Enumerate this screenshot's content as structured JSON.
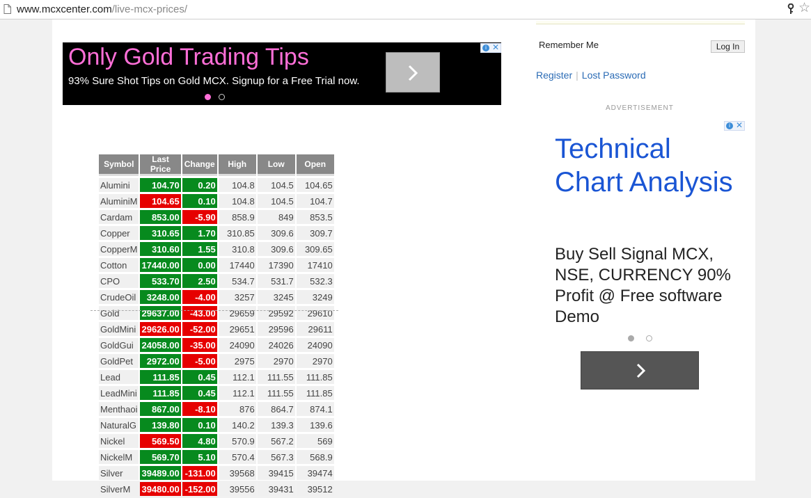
{
  "browser": {
    "url_domain": "www.mcxcenter.com",
    "url_path": "/live-mcx-prices/"
  },
  "ad_top": {
    "headline": "Only Gold Trading Tips",
    "subtext": "93% Sure Shot Tips on Gold MCX. Signup for a Free Trial now."
  },
  "login": {
    "remember_me": "Remember Me",
    "log_in_button": "Log In",
    "register_link": "Register",
    "separator": "|",
    "lost_password_link": "Lost Password"
  },
  "advertisement_label": "ADVERTISEMENT",
  "ad_side": {
    "headline": "Technical Chart Analysis",
    "body": "Buy Sell Signal MCX, NSE, CURRENCY 90% Profit @ Free software Demo"
  },
  "colors": {
    "up": "#078a1e",
    "down": "#e60000",
    "header": "#888888"
  },
  "table": {
    "headers": [
      "Symbol",
      "Last Price",
      "Change",
      "High",
      "Low",
      "Open"
    ],
    "rows": [
      {
        "symbol": "Alumini",
        "last": "104.70",
        "last_dir": "up",
        "change": "0.20",
        "change_dir": "up",
        "high": "104.8",
        "low": "104.5",
        "open": "104.65"
      },
      {
        "symbol": "AluminiM",
        "last": "104.65",
        "last_dir": "down",
        "change": "0.10",
        "change_dir": "up",
        "high": "104.8",
        "low": "104.5",
        "open": "104.7"
      },
      {
        "symbol": "Cardam",
        "last": "853.00",
        "last_dir": "up",
        "change": "-5.90",
        "change_dir": "down",
        "high": "858.9",
        "low": "849",
        "open": "853.5"
      },
      {
        "symbol": "Copper",
        "last": "310.65",
        "last_dir": "up",
        "change": "1.70",
        "change_dir": "up",
        "high": "310.85",
        "low": "309.6",
        "open": "309.7"
      },
      {
        "symbol": "CopperM",
        "last": "310.60",
        "last_dir": "up",
        "change": "1.55",
        "change_dir": "up",
        "high": "310.8",
        "low": "309.6",
        "open": "309.65"
      },
      {
        "symbol": "Cotton",
        "last": "17440.00",
        "last_dir": "up",
        "change": "0.00",
        "change_dir": "up",
        "high": "17440",
        "low": "17390",
        "open": "17410"
      },
      {
        "symbol": "CPO",
        "last": "533.70",
        "last_dir": "up",
        "change": "2.50",
        "change_dir": "up",
        "high": "534.7",
        "low": "531.7",
        "open": "532.3"
      },
      {
        "symbol": "CrudeOil",
        "last": "3248.00",
        "last_dir": "up",
        "change": "-4.00",
        "change_dir": "down",
        "high": "3257",
        "low": "3245",
        "open": "3249"
      },
      {
        "symbol": "Gold",
        "last": "29637.00",
        "last_dir": "up",
        "change": "-43.00",
        "change_dir": "down",
        "high": "29659",
        "low": "29592",
        "open": "29610"
      },
      {
        "symbol": "GoldMini",
        "last": "29626.00",
        "last_dir": "down",
        "change": "-52.00",
        "change_dir": "down",
        "high": "29651",
        "low": "29596",
        "open": "29611"
      },
      {
        "symbol": "GoldGui",
        "last": "24058.00",
        "last_dir": "up",
        "change": "-35.00",
        "change_dir": "down",
        "high": "24090",
        "low": "24026",
        "open": "24090"
      },
      {
        "symbol": "GoldPet",
        "last": "2972.00",
        "last_dir": "up",
        "change": "-5.00",
        "change_dir": "down",
        "high": "2975",
        "low": "2970",
        "open": "2970"
      },
      {
        "symbol": "Lead",
        "last": "111.85",
        "last_dir": "up",
        "change": "0.45",
        "change_dir": "up",
        "high": "112.1",
        "low": "111.55",
        "open": "111.85"
      },
      {
        "symbol": "LeadMini",
        "last": "111.85",
        "last_dir": "up",
        "change": "0.45",
        "change_dir": "up",
        "high": "112.1",
        "low": "111.55",
        "open": "111.85"
      },
      {
        "symbol": "Menthaoi",
        "last": "867.00",
        "last_dir": "up",
        "change": "-8.10",
        "change_dir": "down",
        "high": "876",
        "low": "864.7",
        "open": "874.1"
      },
      {
        "symbol": "NaturalG",
        "last": "139.80",
        "last_dir": "up",
        "change": "0.10",
        "change_dir": "up",
        "high": "140.2",
        "low": "139.3",
        "open": "139.6"
      },
      {
        "symbol": "Nickel",
        "last": "569.50",
        "last_dir": "down",
        "change": "4.80",
        "change_dir": "up",
        "high": "570.9",
        "low": "567.2",
        "open": "569"
      },
      {
        "symbol": "NickelM",
        "last": "569.70",
        "last_dir": "up",
        "change": "5.10",
        "change_dir": "up",
        "high": "570.4",
        "low": "567.3",
        "open": "568.9"
      },
      {
        "symbol": "Silver",
        "last": "39489.00",
        "last_dir": "up",
        "change": "-131.00",
        "change_dir": "down",
        "high": "39568",
        "low": "39415",
        "open": "39474"
      },
      {
        "symbol": "SilverM",
        "last": "39480.00",
        "last_dir": "down",
        "change": "-152.00",
        "change_dir": "down",
        "high": "39556",
        "low": "39431",
        "open": "39512"
      }
    ]
  }
}
